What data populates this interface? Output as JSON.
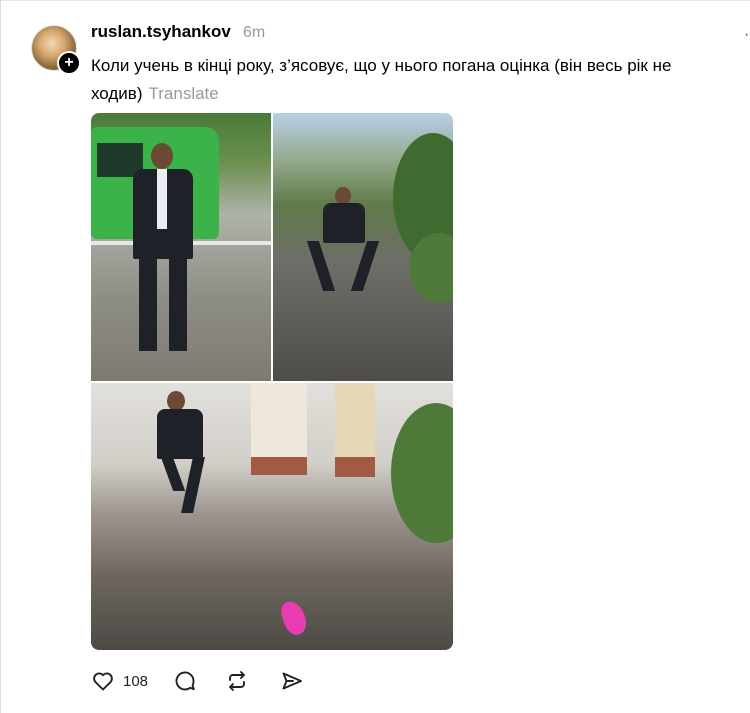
{
  "post": {
    "username": "ruslan.tsyhankov",
    "time": "6m",
    "caption": "Коли учень в кінці року, з’ясовує, що у нього погана оцінка (він весь рік не ходив)",
    "translate_label": "Translate",
    "more_label": "·",
    "follow_badge": "+"
  },
  "actions": {
    "like_count": "108",
    "icons": [
      "heart-icon",
      "comment-icon",
      "repost-icon",
      "share-icon"
    ]
  },
  "colors": {
    "muted": "#999999",
    "accent": "#000000"
  }
}
